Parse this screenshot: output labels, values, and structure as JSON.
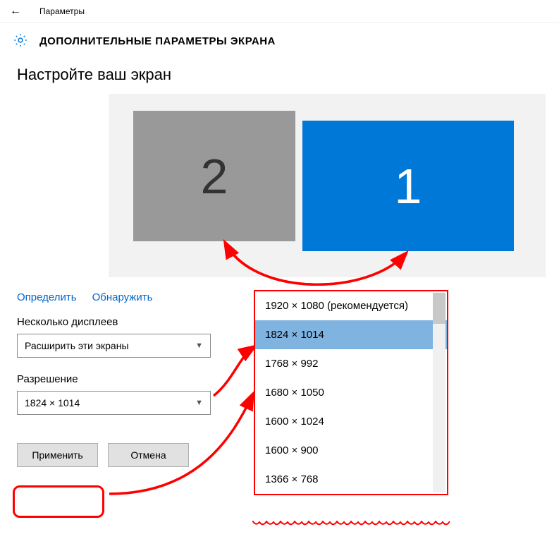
{
  "titlebar": {
    "app_name": "Параметры"
  },
  "header": {
    "title": "ДОПОЛНИТЕЛЬНЫЕ ПАРАМЕТРЫ ЭКРАНА"
  },
  "section": {
    "configure_title": "Настройте ваш экран"
  },
  "monitors": {
    "m1_label": "1",
    "m2_label": "2"
  },
  "links": {
    "identify": "Определить",
    "detect": "Обнаружить"
  },
  "multi_display": {
    "label": "Несколько дисплеев",
    "selected": "Расширить эти экраны"
  },
  "resolution": {
    "label": "Разрешение",
    "selected": "1824 × 1014",
    "options": [
      "1920 × 1080 (рекомендуется)",
      "1824 × 1014",
      "1768 × 992",
      "1680 × 1050",
      "1600 × 1024",
      "1600 × 900",
      "1366 × 768"
    ]
  },
  "buttons": {
    "apply": "Применить",
    "cancel": "Отмена"
  },
  "annotation": {
    "color": "#ff0000"
  }
}
